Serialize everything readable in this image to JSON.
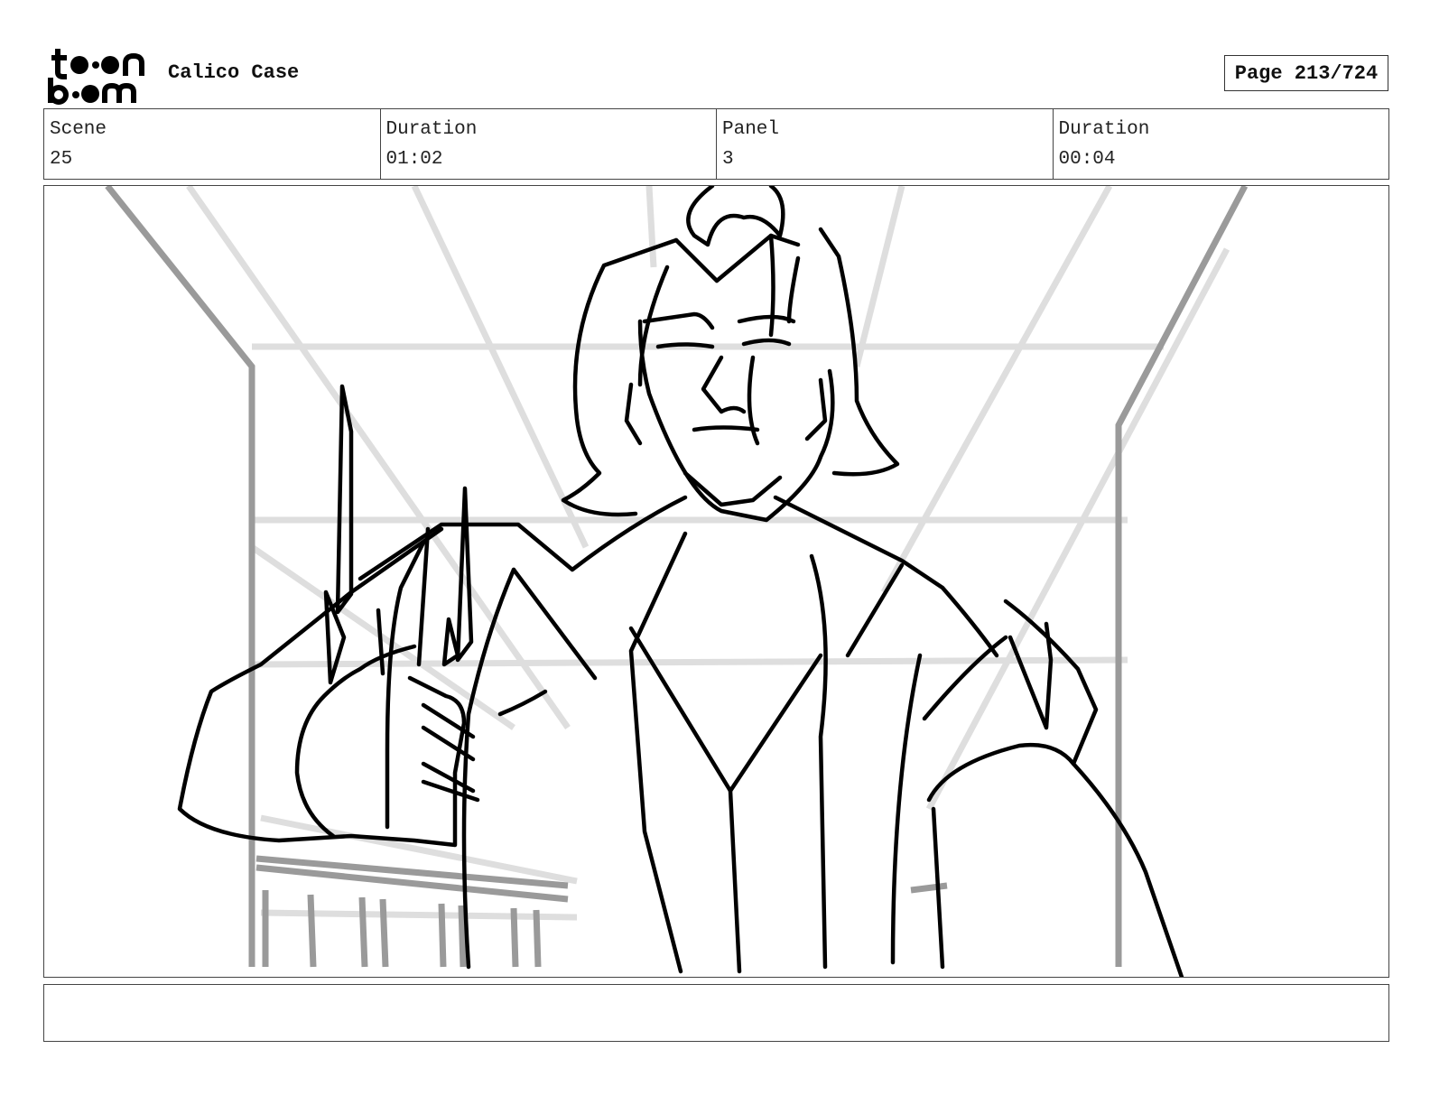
{
  "header": {
    "project_title": "Calico Case",
    "page_label": "Page 213/724"
  },
  "logo": {
    "text_top": "toon",
    "text_bottom": "boom"
  },
  "info": [
    {
      "label": "Scene",
      "value": "25"
    },
    {
      "label": "Duration",
      "value": "01:02"
    },
    {
      "label": "Panel",
      "value": "3"
    },
    {
      "label": "Duration",
      "value": "00:04"
    }
  ],
  "notes": {
    "text": ""
  },
  "colors": {
    "ink": "#000000",
    "background_lines_light": "#dcdcdc",
    "background_lines_mid": "#9a9a9a",
    "frame": "#444444"
  }
}
